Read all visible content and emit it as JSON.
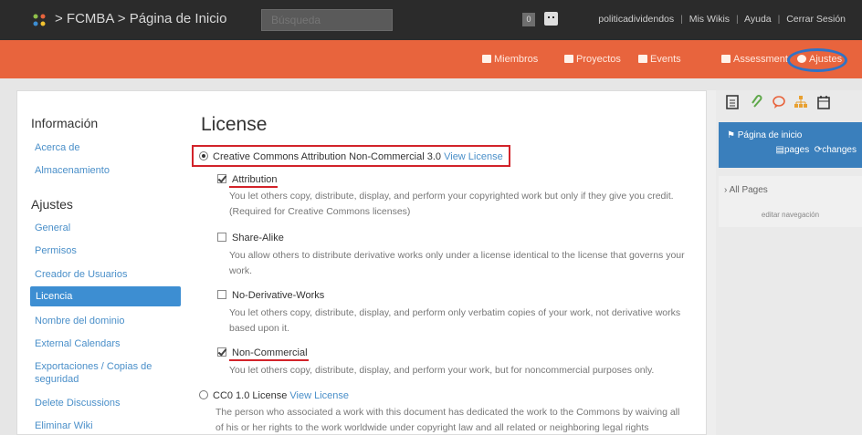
{
  "topbar": {
    "breadcrumb": "> FCMBA > Página de Inicio",
    "search_placeholder": "Búsqueda",
    "notification_count": "0",
    "username": "politicadividendos",
    "link_my_wikis": "Mis Wikis",
    "link_help": "Ayuda",
    "link_logout": "Cerrar Sesión",
    "separator": "|"
  },
  "navbar": {
    "members": "Miembros",
    "projects": "Proyectos",
    "events": "Events",
    "assessment": "Assessment",
    "settings": "Ajustes"
  },
  "sidebar": {
    "info_heading": "Información",
    "about": "Acerca de",
    "storage": "Almacenamiento",
    "settings_heading": "Ajustes",
    "general": "General",
    "permissions": "Permisos",
    "user_creator": "Creador de Usuarios",
    "license": "Licencia",
    "domain_name": "Nombre del dominio",
    "external_calendars": "External Calendars",
    "exports_line1": "Exportaciones / Copias de",
    "exports_line2": "seguridad",
    "delete_discussions": "Delete Discussions",
    "delete_wiki": "Eliminar Wiki"
  },
  "license": {
    "title": "License",
    "option_cc": "Creative Commons Attribution Non-Commercial 3.0",
    "view_license": "View License",
    "attribution_label": "Attribution",
    "attribution_desc": "You let others copy, distribute, display, and perform your copyrighted work but only if they give you credit. (Required for Creative Commons licenses)",
    "sharealike_label": "Share-Alike",
    "sharealike_desc": "You allow others to distribute derivative works only under a license identical to the license that governs your work.",
    "noderiv_label": "No-Derivative-Works",
    "noderiv_desc": "You let others copy, distribute, display, and perform only verbatim copies of your work, not derivative works based upon it.",
    "noncommercial_label": "Non-Commercial",
    "noncommercial_desc": "You let others copy, distribute, display, and perform your work, but for noncommercial purposes only.",
    "option_cc0": "CC0 1.0 License",
    "cc0_desc": "The person who associated a work with this document has dedicated the work to the Commons by waiving all of his or her rights to the work worldwide under copyright law and all related or neighboring legal rights"
  },
  "right": {
    "home_page": "Página de inicio",
    "pages": "pages",
    "changes": "changes",
    "all_pages": "All Pages",
    "edit_nav": "editar navegación"
  },
  "colors": {
    "topbar": "#2b2b2b",
    "navbar": "#e8643d",
    "accent": "#3d8ed2",
    "highlight": "#d2232a",
    "settings_ring": "#2f73c6"
  }
}
